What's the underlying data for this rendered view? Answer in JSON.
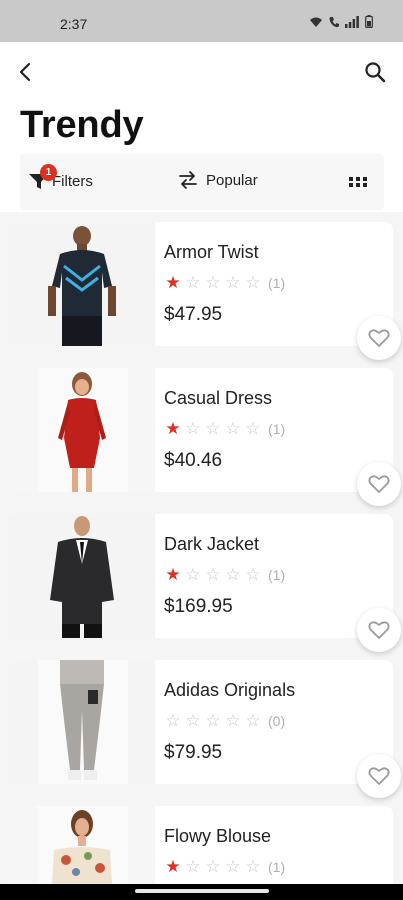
{
  "status_bar": {
    "time": "2:37",
    "icons": [
      "wifi-icon",
      "call-icon",
      "signal-icon",
      "battery-icon"
    ]
  },
  "header": {
    "title": "Trendy",
    "back_icon": "back-arrow-icon",
    "search_icon": "search-icon"
  },
  "toolbar": {
    "filters_label": "Filters",
    "filters_badge": "1",
    "sort_label": "Popular",
    "view_icon": "grid-view-icon"
  },
  "colors": {
    "accent": "#db3022",
    "star_empty": "#c8c8c8",
    "background": "#f5f5f5"
  },
  "products": [
    {
      "name": "Armor Twist",
      "rating": 1,
      "max_rating": 5,
      "reviews": "(1)",
      "price": "$47.95"
    },
    {
      "name": "Casual Dress",
      "rating": 1,
      "max_rating": 5,
      "reviews": "(1)",
      "price": "$40.46"
    },
    {
      "name": "Dark Jacket",
      "rating": 1,
      "max_rating": 5,
      "reviews": "(1)",
      "price": "$169.95"
    },
    {
      "name": "Adidas Originals",
      "rating": 0,
      "max_rating": 5,
      "reviews": "(0)",
      "price": "$79.95"
    },
    {
      "name": "Flowy Blouse",
      "rating": 1,
      "max_rating": 5,
      "reviews": "(1)",
      "price": ""
    }
  ]
}
